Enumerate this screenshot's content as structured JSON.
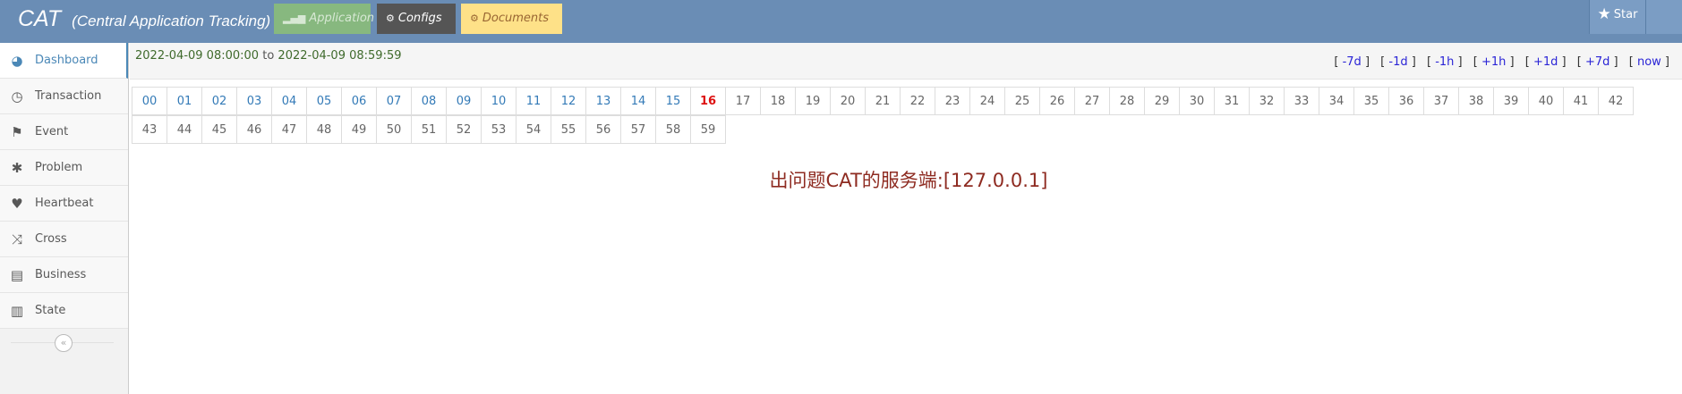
{
  "header": {
    "brand": "CAT",
    "brand_sub": "(Central Application Tracking)",
    "buttons": [
      {
        "label": "Application",
        "icon": "signal-icon"
      },
      {
        "label": "Configs",
        "icon": "cogs-icon"
      },
      {
        "label": "Documents",
        "icon": "cogs-icon"
      }
    ],
    "star_label": "Star"
  },
  "sidebar": {
    "items": [
      {
        "label": "Dashboard",
        "icon": "dashboard-icon",
        "active": true
      },
      {
        "label": "Transaction",
        "icon": "clock-icon"
      },
      {
        "label": "Event",
        "icon": "flag-icon"
      },
      {
        "label": "Problem",
        "icon": "bug-icon"
      },
      {
        "label": "Heartbeat",
        "icon": "heart-icon"
      },
      {
        "label": "Cross",
        "icon": "random-icon"
      },
      {
        "label": "Business",
        "icon": "credit-card-icon"
      },
      {
        "label": "State",
        "icon": "bar-chart-icon"
      }
    ],
    "collapse_icon": "double-angle-left-icon"
  },
  "timebar": {
    "start": "2022-04-09 08:00:00",
    "to": "to",
    "end": "2022-04-09 08:59:59",
    "nav": [
      "-7d",
      "-1d",
      "-1h",
      "+1h",
      "+1d",
      "+7d",
      "now"
    ]
  },
  "minutes": {
    "row1": [
      "00",
      "01",
      "02",
      "03",
      "04",
      "05",
      "06",
      "07",
      "08",
      "09",
      "10",
      "11",
      "12",
      "13",
      "14",
      "15",
      "16",
      "17",
      "18",
      "19",
      "20",
      "21",
      "22",
      "23",
      "24",
      "25",
      "26",
      "27",
      "28",
      "29",
      "30",
      "31",
      "32",
      "33",
      "34",
      "35",
      "36",
      "37",
      "38",
      "39",
      "40",
      "41",
      "42"
    ],
    "row2": [
      "43",
      "44",
      "45",
      "46",
      "47",
      "48",
      "49",
      "50",
      "51",
      "52",
      "53",
      "54",
      "55",
      "56",
      "57",
      "58",
      "59"
    ],
    "current": "16",
    "linked_count": 16
  },
  "message": "出问题CAT的服务端:[127.0.0.1]",
  "colors": {
    "navbar": "#6a8db5",
    "application_btn": "#87b87f",
    "configs_btn": "#555555",
    "documents_btn": "#fee188",
    "active_accent": "#4b88b7",
    "current_minute": "#dd1111",
    "message": "#8e2b21"
  }
}
